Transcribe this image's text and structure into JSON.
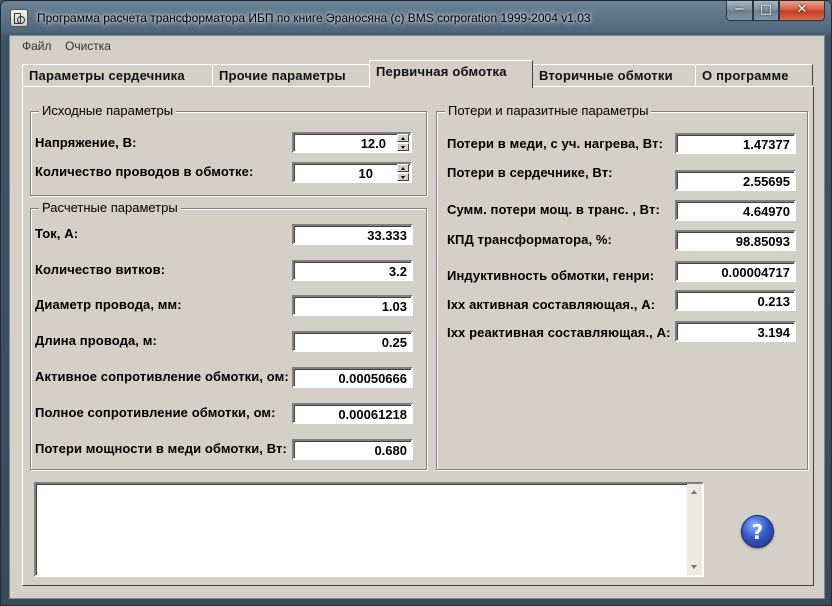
{
  "window": {
    "title": "Программа расчета трансформатора ИБП по книге Эраносяна        (c) BMS corporation 1999-2004  v1.03",
    "minimize_glyph": "−",
    "maximize_glyph": "□",
    "close_glyph": "✕"
  },
  "menu": {
    "file": "Файл",
    "clear": "Очистка"
  },
  "tabs": [
    {
      "label": "Параметры сердечника"
    },
    {
      "label": "Прочие параметры"
    },
    {
      "label": "Первичная обмотка",
      "active": true
    },
    {
      "label": "Вторичные обмотки"
    },
    {
      "label": "О программе"
    }
  ],
  "input_group": {
    "title": "Исходные параметры",
    "voltage_label": "Напряжение, В:",
    "voltage_value": "12.0",
    "wires_label": "Количество проводов в обмотке:",
    "wires_value": "10"
  },
  "calc_group": {
    "title": "Расчетные параметры",
    "rows": [
      {
        "label": "Ток, А:",
        "value": "33.333"
      },
      {
        "label": "Количество витков:",
        "value": "3.2"
      },
      {
        "label": "Диаметр провода, мм:",
        "value": "1.03"
      },
      {
        "label": "Длина провода, м:",
        "value": "0.25"
      },
      {
        "label": "Активное сопротивление обмотки, ом:",
        "value": "0.00050666"
      },
      {
        "label": "Полное сопротивление обмотки, ом:",
        "value": "0.00061218"
      },
      {
        "label": "Потери мощности в меди обмотки, Вт:",
        "value": "0.680"
      }
    ]
  },
  "loss_group": {
    "title": "Потери и паразитные параметры",
    "rows": [
      {
        "label": "Потери в меди, с уч. нагрева, Вт:",
        "value": "1.47377"
      },
      {
        "label": "Потери в сердечнике, Вт:",
        "value": "2.55695"
      },
      {
        "label": "Сумм. потери мощ. в транс. , Вт:",
        "value": "4.64970"
      },
      {
        "label": "КПД трансформатора, %:",
        "value": "98.85093"
      },
      {
        "label": "Индуктивность обмотки, генри:",
        "value": "0.00004717"
      },
      {
        "label": "Iхх активная составляющая., А:",
        "value": "0.213"
      },
      {
        "label": "Iхх реактивная составляющая., А:",
        "value": "3.194"
      }
    ]
  },
  "memo": {
    "value": ""
  },
  "help": {
    "glyph": "?"
  }
}
